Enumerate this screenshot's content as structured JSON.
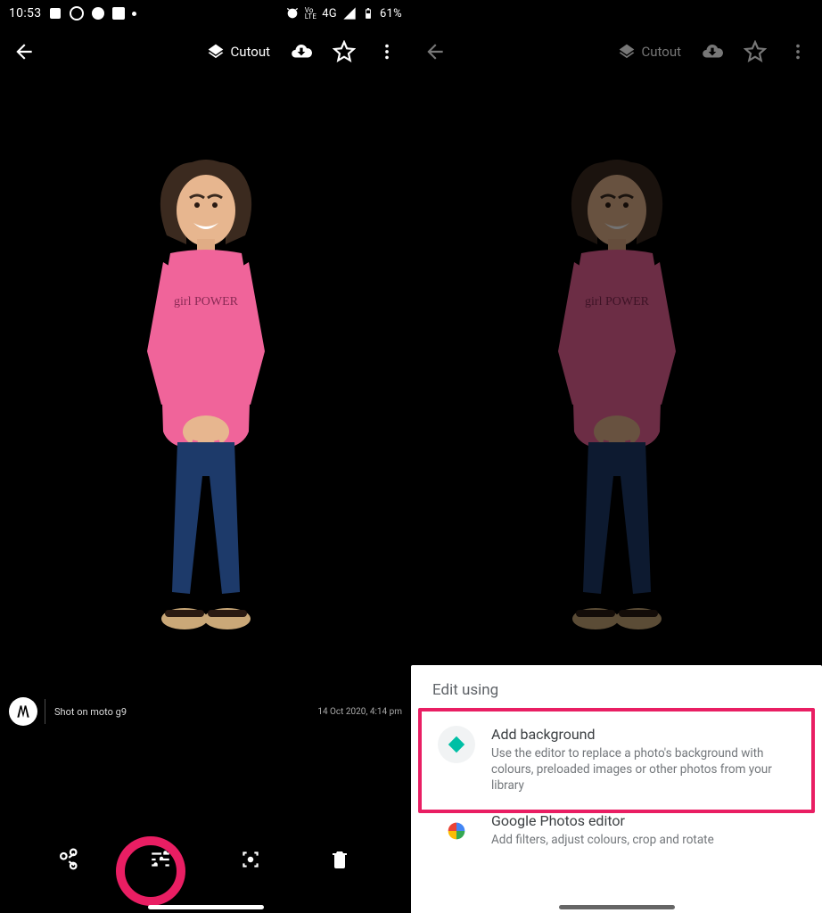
{
  "status": {
    "time": "10:53",
    "battery": "61%",
    "network": "4G",
    "lte": "Vo\nLTE"
  },
  "toolbar": {
    "cutout_label": "Cutout"
  },
  "camera": {
    "shot_on": "Shot on moto g9",
    "date": "14 Oct 2020, 4:14 pm"
  },
  "sheet": {
    "title": "Edit using",
    "items": [
      {
        "title": "Add background",
        "desc": "Use the editor to replace a photo's background with colours, preloaded images or other photos from your library"
      },
      {
        "title": "Google Photos editor",
        "desc": "Add filters, adjust colours, crop and rotate"
      }
    ]
  }
}
